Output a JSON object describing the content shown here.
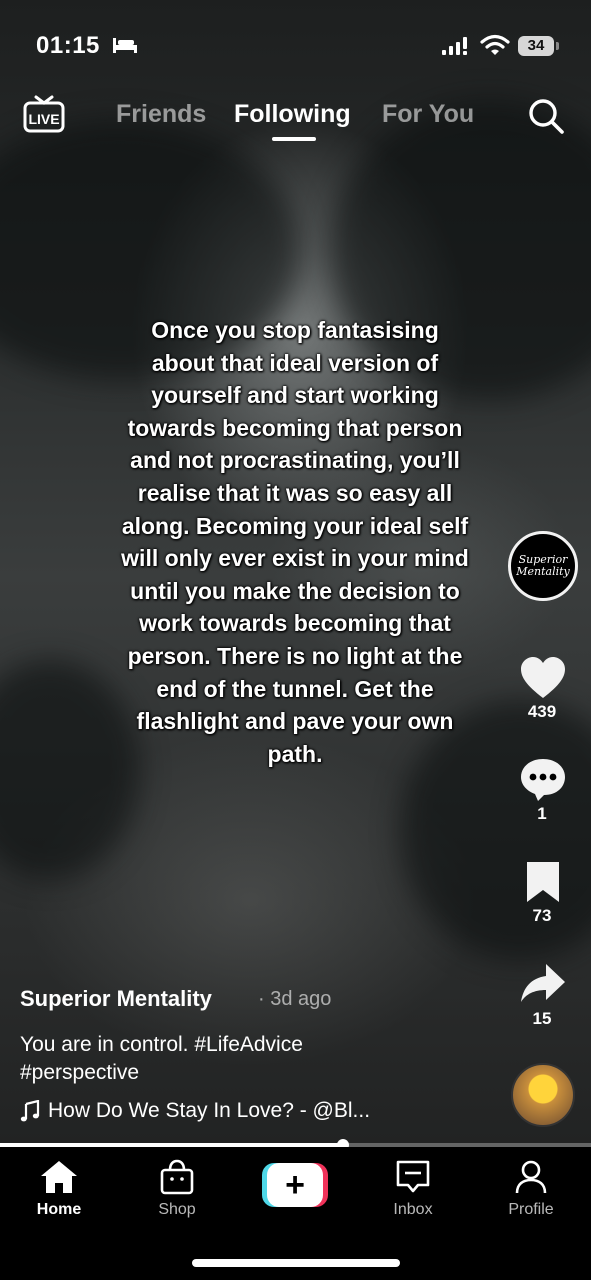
{
  "status_bar": {
    "time": "01:15",
    "battery": "34"
  },
  "top_nav": {
    "live_label": "LIVE",
    "tabs": [
      {
        "label": "Friends"
      },
      {
        "label": "Following"
      },
      {
        "label": "For You"
      }
    ],
    "active_tab": "Following"
  },
  "video": {
    "caption": "Once you stop fantasising about that ideal version of yourself and start working towards becoming that person and not procrastinating, you’ll realise that it was so easy all along. Becoming your ideal self will only ever exist in your mind until you make the decision to work towards becoming that person. There is no light at the end of the tunnel. Get the flashlight and pave your own path.",
    "progress_fraction": 0.58
  },
  "side_actions": {
    "avatar_text": "Superior Mentality",
    "likes": "439",
    "comments": "1",
    "saves": "73",
    "shares": "15"
  },
  "post_info": {
    "author": "Superior Mentality",
    "time_ago": "· 3d ago",
    "description_line1": "You are in control. #LifeAdvice",
    "description_line2": "#perspective",
    "music": "How Do We Stay In Love? - @Bl..."
  },
  "bottom_nav": {
    "home": "Home",
    "shop": "Shop",
    "create": "+",
    "inbox": "Inbox",
    "profile": "Profile"
  },
  "colors": {
    "create_cyan": "#4fd8e8",
    "create_red": "#f0325a"
  }
}
